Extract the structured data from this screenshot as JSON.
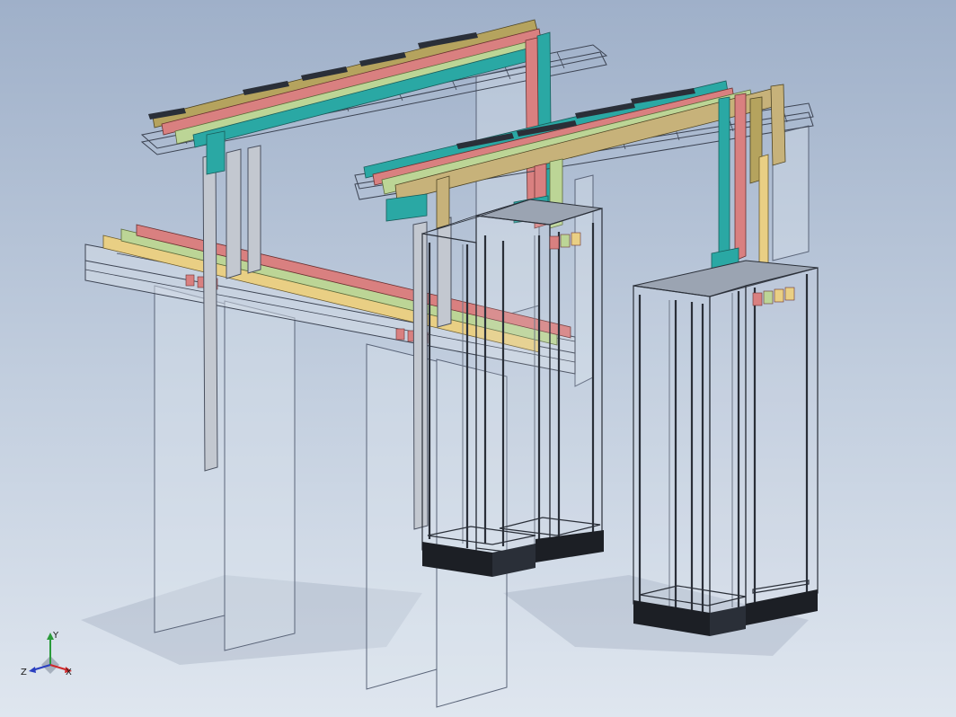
{
  "viewport": {
    "background_top": "#9fb0c9",
    "background_bottom": "#dfe6ef"
  },
  "colors": {
    "frame": "#2a2f38",
    "frame_light": "#6f7887",
    "glass_fill": "#dde4ee",
    "glass_edge": "#5a6478",
    "tray_edge": "#3c4352",
    "teal": "#2aa8a4",
    "olive": "#b5a35e",
    "red": "#d98080",
    "green": "#bcd596",
    "yellow": "#e9cf84",
    "tan": "#c7b27a",
    "base": "#1c1f25",
    "cabinet_top": "#9ba4b2"
  },
  "triad": {
    "x_label": "X",
    "y_label": "Y",
    "z_label": "Z",
    "x_color": "#d0282a",
    "y_color": "#2a9a3a",
    "z_color": "#2a3fc0"
  }
}
